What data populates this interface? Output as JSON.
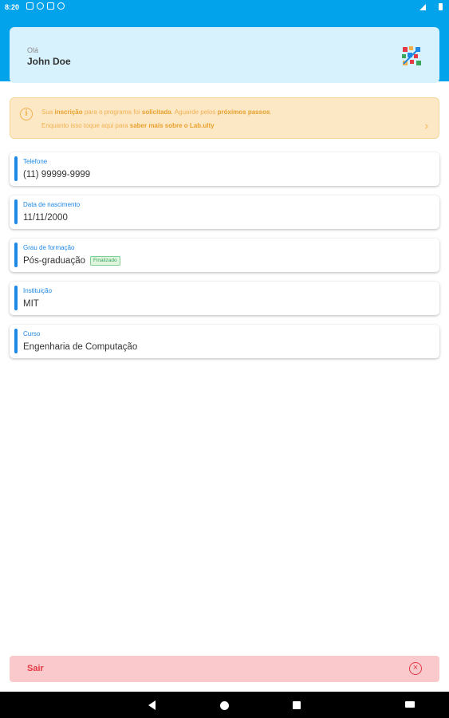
{
  "status_bar": {
    "time": "8:20"
  },
  "header": {
    "greeting": "Olá",
    "user_name": "John Doe"
  },
  "notice": {
    "line1": [
      {
        "text": "Sua ",
        "bold": false
      },
      {
        "text": "inscrição",
        "bold": true
      },
      {
        "text": " para o programa foi ",
        "bold": false
      },
      {
        "text": "solicitada",
        "bold": true
      },
      {
        "text": ". Aguarde pelos ",
        "bold": false
      },
      {
        "text": "próximos passos",
        "bold": true
      },
      {
        "text": ".",
        "bold": false
      }
    ],
    "line2": [
      {
        "text": "Enquanto isso toque aqui para ",
        "bold": false
      },
      {
        "text": "saber mais sobre o Lab.ulty",
        "bold": true
      }
    ]
  },
  "fields": [
    {
      "label": "Telefone",
      "value": "(11) 99999-9999"
    },
    {
      "label": "Data de nascimento",
      "value": "11/11/2000"
    },
    {
      "label": "Grau de formação",
      "value": "Pós-graduação",
      "badge": "Finalizado"
    },
    {
      "label": "Instituição",
      "value": "MIT"
    },
    {
      "label": "Curso",
      "value": "Engenharia de Computação"
    }
  ],
  "logout": {
    "label": "Sair"
  },
  "colors": {
    "primary": "#03a3ec",
    "accent_blue": "#1e88e5",
    "warning": "#f2b04a",
    "danger": "#e53945",
    "success": "#3aa65a"
  },
  "icons": {
    "notice": "info-icon",
    "notice_action": "chevron-right-icon",
    "logout": "close-circle-icon",
    "brand": "app-logo-icon"
  }
}
